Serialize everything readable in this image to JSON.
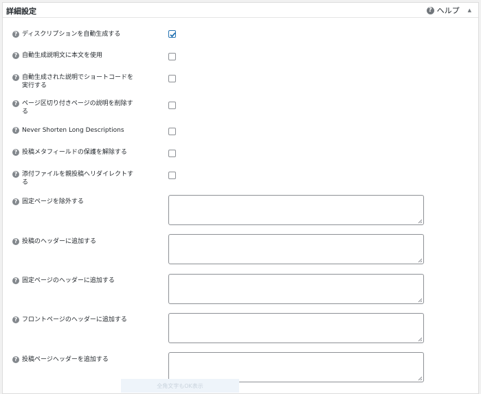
{
  "panel": {
    "title": "詳細設定",
    "help_label": "ヘルプ",
    "collapse_glyph": "▲",
    "help_glyph": "?"
  },
  "checkbox_rows": [
    {
      "label": "ディスクリプションを自動生成する",
      "checked": true
    },
    {
      "label": "自動生成説明文に本文を使用",
      "checked": false
    },
    {
      "label": "自動生成された説明でショートコードを実行する",
      "checked": false
    },
    {
      "label": "ページ区切り付きページの説明を削除する",
      "checked": false
    },
    {
      "label": "Never Shorten Long Descriptions",
      "checked": false
    },
    {
      "label": "投稿メタフィールドの保護を解除する",
      "checked": false
    },
    {
      "label": "添付ファイルを親投稿へリダイレクトする",
      "checked": false
    }
  ],
  "textarea_rows": [
    {
      "label": "固定ページを除外する",
      "value": ""
    },
    {
      "label": "投稿のヘッダーに追加する",
      "value": ""
    },
    {
      "label": "固定ページのヘッダーに追加する",
      "value": ""
    },
    {
      "label": "フロントページのヘッダーに追加する",
      "value": ""
    },
    {
      "label": "投稿ページヘッダーを追加する",
      "value": ""
    }
  ],
  "footer": {
    "faded_text": "全角文字もOK表示"
  },
  "colors": {
    "accent": "#2271b1",
    "help_icon": "#82878c"
  }
}
